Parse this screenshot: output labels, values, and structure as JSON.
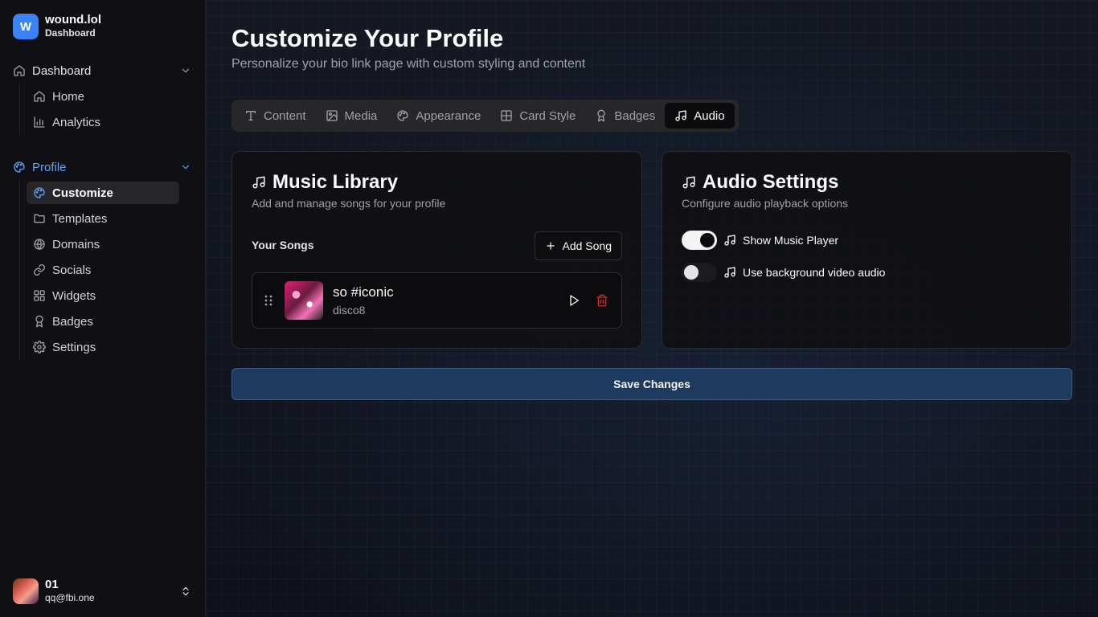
{
  "brand": {
    "logo_letter": "W",
    "name": "wound.lol",
    "subtitle": "Dashboard",
    "logo_color": "#3b82f6"
  },
  "sidebar": {
    "groups": [
      {
        "label": "Dashboard",
        "icon": "home-icon",
        "items": [
          {
            "label": "Home",
            "icon": "home-icon"
          },
          {
            "label": "Analytics",
            "icon": "bar-chart-icon"
          }
        ]
      },
      {
        "label": "Profile",
        "icon": "palette-icon",
        "active": true,
        "items": [
          {
            "label": "Customize",
            "icon": "palette-icon",
            "selected": true
          },
          {
            "label": "Templates",
            "icon": "folder-icon"
          },
          {
            "label": "Domains",
            "icon": "globe-icon"
          },
          {
            "label": "Socials",
            "icon": "link-icon"
          },
          {
            "label": "Widgets",
            "icon": "grid-icon"
          },
          {
            "label": "Badges",
            "icon": "award-icon"
          },
          {
            "label": "Settings",
            "icon": "gear-icon"
          }
        ]
      }
    ]
  },
  "user": {
    "name": "01",
    "email": "qq@fbi.one"
  },
  "page": {
    "title": "Customize Your Profile",
    "subtitle": "Personalize your bio link page with custom styling and content"
  },
  "tabs": [
    {
      "label": "Content",
      "icon": "type-icon"
    },
    {
      "label": "Media",
      "icon": "image-icon"
    },
    {
      "label": "Appearance",
      "icon": "palette-icon"
    },
    {
      "label": "Card Style",
      "icon": "layout-grid-icon"
    },
    {
      "label": "Badges",
      "icon": "award-icon"
    },
    {
      "label": "Audio",
      "icon": "music-icon",
      "active": true
    }
  ],
  "music_library": {
    "title": "Music Library",
    "description": "Add and manage songs for your profile",
    "songs_label": "Your Songs",
    "add_song_label": "Add Song",
    "songs": [
      {
        "title": "so #iconic",
        "artist": "disco8"
      }
    ]
  },
  "audio_settings": {
    "title": "Audio Settings",
    "description": "Configure audio playback options",
    "options": [
      {
        "label": "Show Music Player",
        "enabled": true
      },
      {
        "label": "Use background video audio",
        "enabled": false
      }
    ]
  },
  "save_label": "Save Changes",
  "colors": {
    "accent": "#60a5fa",
    "danger": "#dc2626",
    "save_bg": "#1e3a5f"
  }
}
